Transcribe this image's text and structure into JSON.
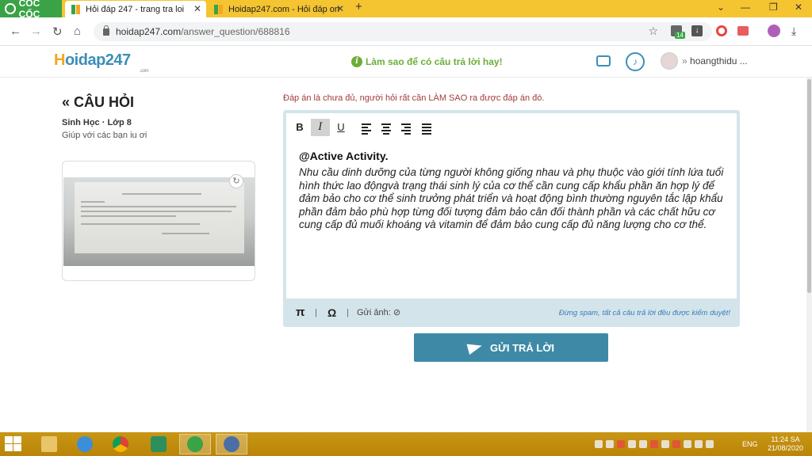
{
  "browser": {
    "brand": "CỐC CỐC",
    "tabs": [
      {
        "title": "Hỏi đáp 247 - trang tra loi",
        "active": true
      },
      {
        "title": "Hoidap247.com - Hỏi đáp on",
        "active": false
      }
    ],
    "new_tab": "+",
    "url_host": "hoidap247.com",
    "url_path": "/answer_question/688816",
    "download_badge": "14"
  },
  "site": {
    "logo_main": "oidap247",
    "logo_h": "H",
    "logo_sub": ".com",
    "tip": "Làm sao để có câu trả lời hay!",
    "username": "hoangthidu ..."
  },
  "question": {
    "heading": "CÂU HỎI",
    "subject": "Sinh Học · Lớp 8",
    "text": "Giúp với các bạn iu ơi"
  },
  "answer": {
    "warning": "Đáp án là chưa đủ, người hỏi rất cần LÀM SAO ra được đáp án đó.",
    "toolbar": {
      "bold": "B",
      "italic": "I",
      "underline": "U"
    },
    "mention": "@Active Activity.",
    "body": "Nhu cầu dinh dưỡng của từng người không giống nhau và phụ thuộc vào giới tính lứa tuổi hình thức lao độngvà trạng thái sinh lý của cơ thể cần cung cấp khẩu phần ăn hợp lý để đảm bảo cho cơ thể sinh trưởng phát triển và hoạt động bình thường nguyên tắc lập khẩu phần đảm bảo phù hợp từng đối tượng đảm bảo cân đối thành phần và các chất hữu cơ cung cấp đủ muối khoáng và vitamin để đảm bảo cung cấp đủ năng lượng cho cơ thể.",
    "footer": {
      "pi": "π",
      "omega": "Ω",
      "attach_label": "Gửi ảnh:",
      "spam_note": "Đừng spam, tất cả câu trả lời đều được kiểm duyệt!"
    },
    "submit_label": "GỬI TRẢ LỜI"
  },
  "taskbar": {
    "lang": "ENG",
    "time": "11:24 SA",
    "date": "21/08/2020"
  }
}
